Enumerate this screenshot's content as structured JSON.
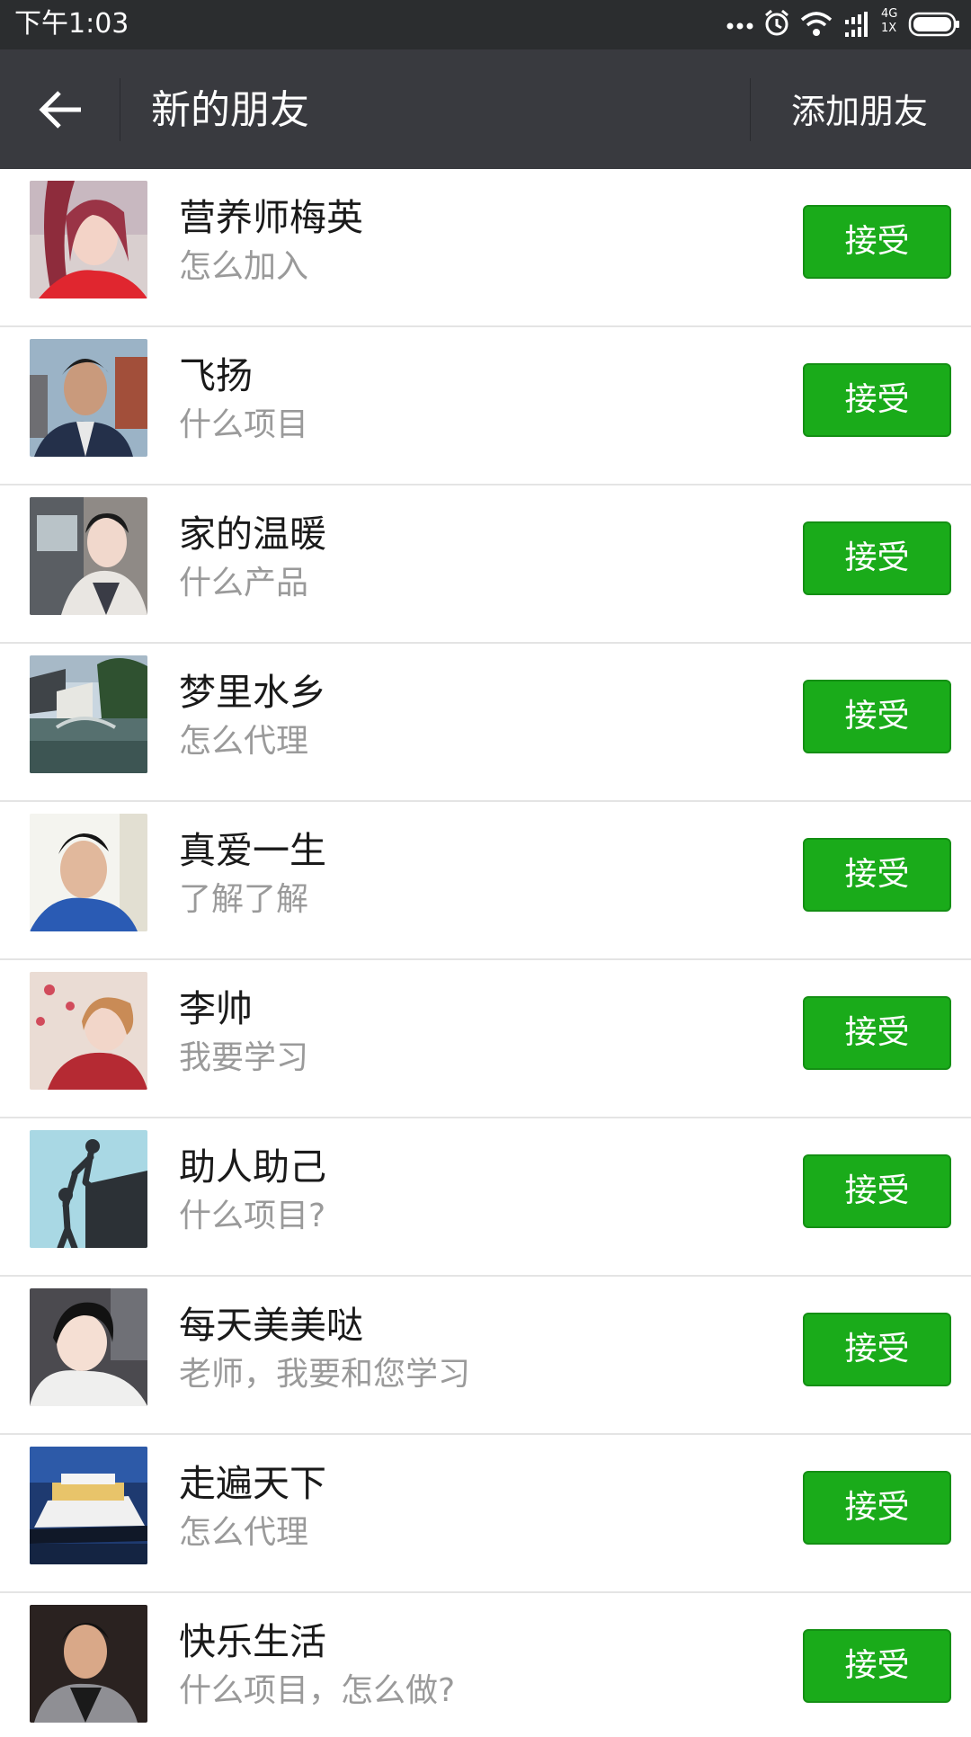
{
  "status_bar": {
    "time": "下午1:03",
    "network_top": "4G",
    "network_bottom": "1X"
  },
  "app_bar": {
    "title": "新的朋友",
    "action": "添加朋友",
    "back_icon": "arrow-left-icon"
  },
  "colors": {
    "accent": "#1aab1a",
    "app_bar_bg": "#393a3f",
    "status_bar_bg": "#2b2d2f"
  },
  "requests": [
    {
      "name": "营养师梅英",
      "message": "怎么加入",
      "button": "接受"
    },
    {
      "name": "飞扬",
      "message": "什么项目",
      "button": "接受"
    },
    {
      "name": "家的温暖",
      "message": "什么产品",
      "button": "接受"
    },
    {
      "name": "梦里水乡",
      "message": "怎么代理",
      "button": "接受"
    },
    {
      "name": "真爱一生",
      "message": "了解了解",
      "button": "接受"
    },
    {
      "name": "李帅",
      "message": "我要学习",
      "button": "接受"
    },
    {
      "name": "助人助己",
      "message": "什么项目?",
      "button": "接受"
    },
    {
      "name": "每天美美哒",
      "message": "老师，我要和您学习",
      "button": "接受"
    },
    {
      "name": "走遍天下",
      "message": "怎么代理",
      "button": "接受"
    },
    {
      "name": "快乐生活",
      "message": "什么项目，怎么做?",
      "button": "接受"
    }
  ]
}
